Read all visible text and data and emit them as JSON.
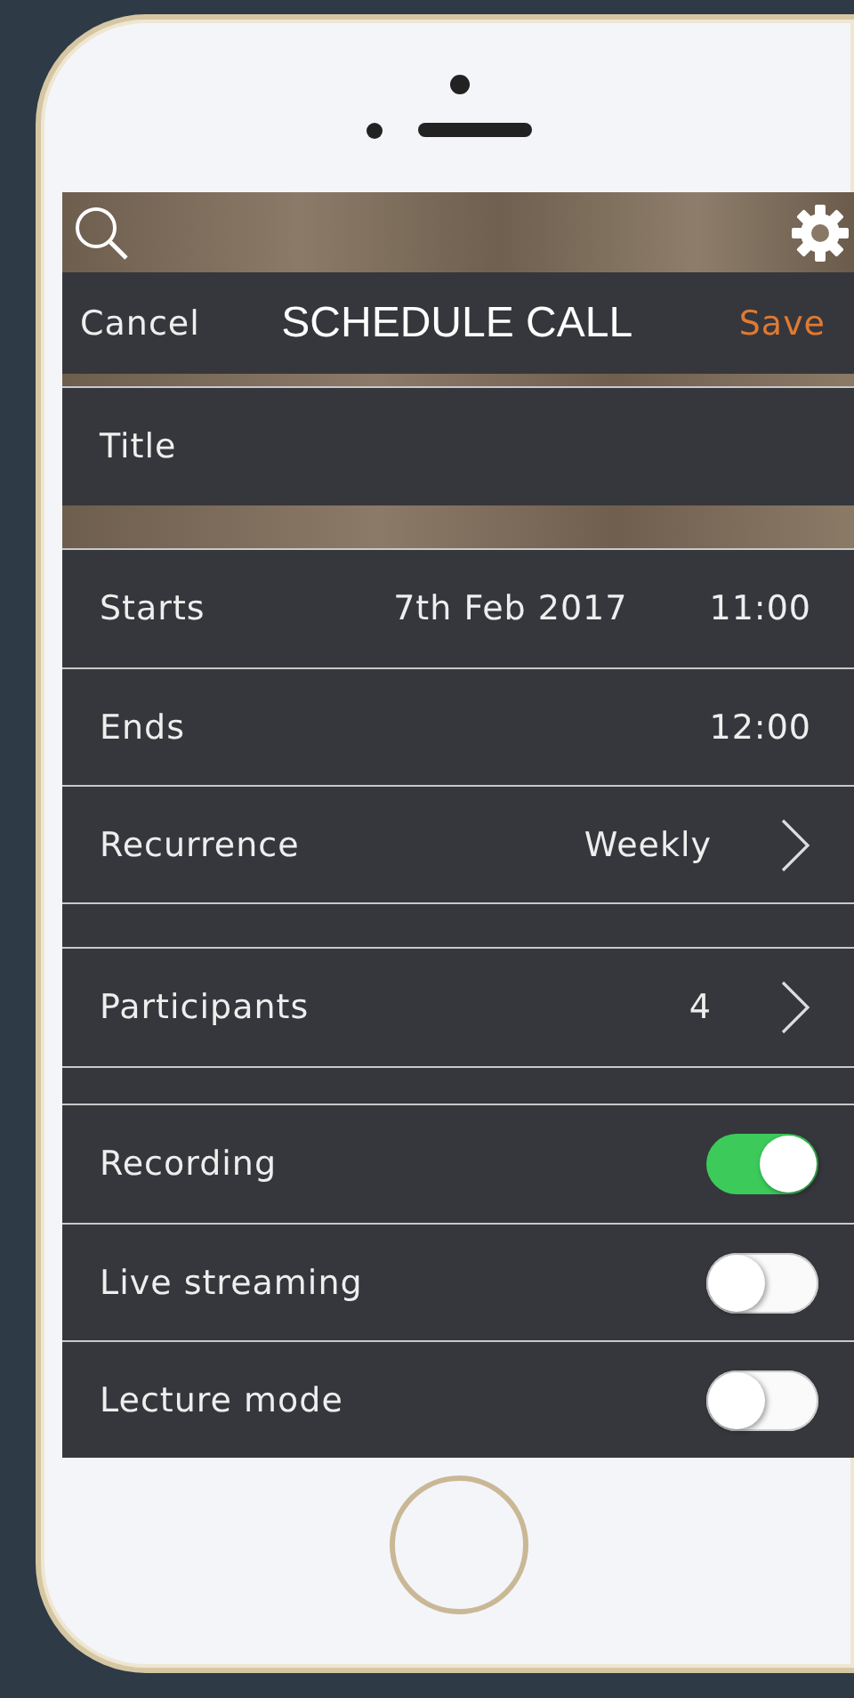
{
  "header": {
    "cancel": "Cancel",
    "title": "SCHEDULE CALL",
    "save": "Save"
  },
  "sections": [
    {
      "rows": [
        {
          "kind": "field",
          "label": "Title"
        }
      ]
    },
    {
      "rows": [
        {
          "kind": "detail",
          "label": "Starts",
          "value": "7th Feb 2017",
          "time": "11:00"
        },
        {
          "kind": "detail",
          "label": "Ends",
          "time": "12:00"
        },
        {
          "kind": "disclosure",
          "label": "Recurrence",
          "value": "Weekly"
        }
      ]
    },
    {
      "rows": [
        {
          "kind": "disclosure",
          "label": "Participants",
          "value": "4"
        }
      ]
    },
    {
      "rows": [
        {
          "kind": "toggle",
          "label": "Recording",
          "on": true
        },
        {
          "kind": "toggle",
          "label": "Live streaming",
          "on": false
        },
        {
          "kind": "toggle",
          "label": "Lecture mode",
          "on": false
        }
      ]
    }
  ]
}
